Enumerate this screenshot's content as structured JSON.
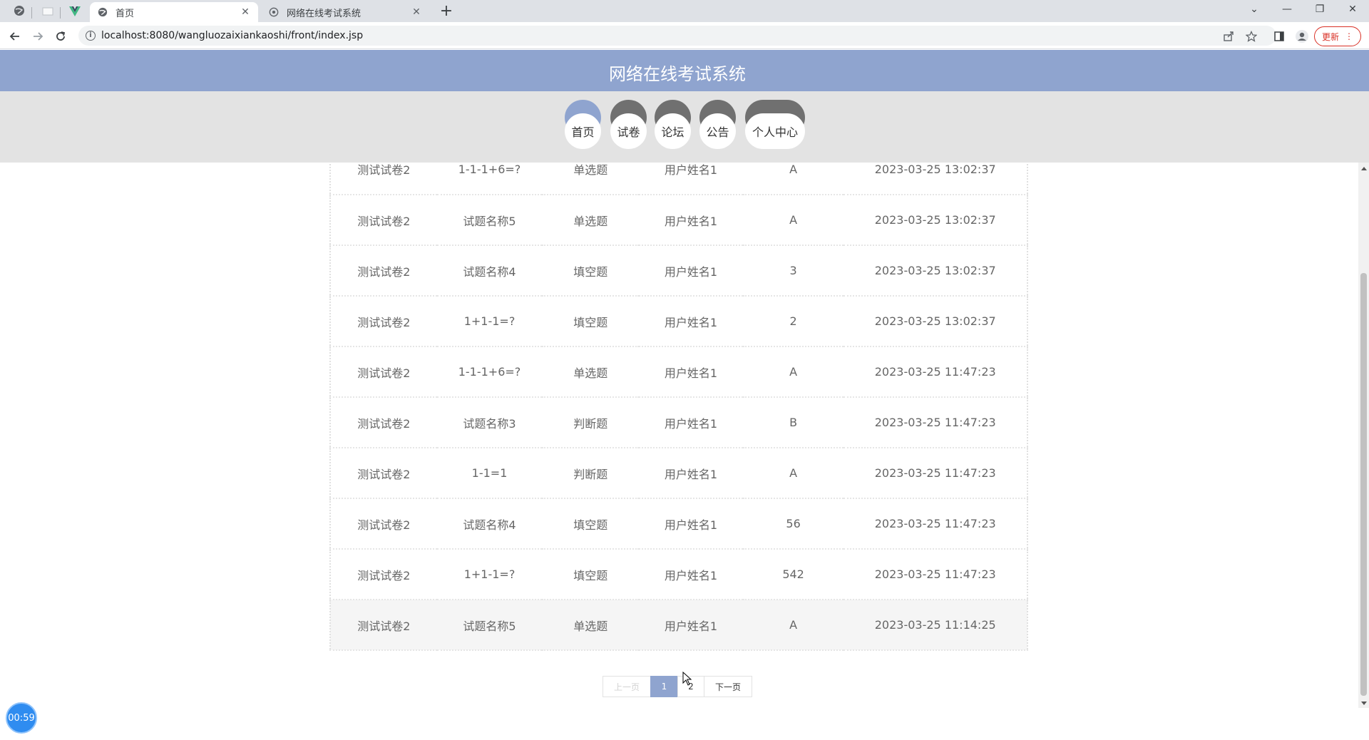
{
  "browser": {
    "tabs": [
      {
        "label": "首页",
        "active": true
      },
      {
        "label": "网络在线考试系统",
        "active": false
      }
    ],
    "url": "localhost:8080/wangluozaixiankaoshi/front/index.jsp",
    "update_label": "更新"
  },
  "site": {
    "title": "网络在线考试系统",
    "nav": [
      {
        "label": "首页",
        "active": true
      },
      {
        "label": "试卷",
        "active": false
      },
      {
        "label": "论坛",
        "active": false
      },
      {
        "label": "公告",
        "active": false
      },
      {
        "label": "个人中心",
        "active": false
      }
    ]
  },
  "records": [
    [
      "测试试卷2",
      "1-1-1+6=?",
      "单选题",
      "用户姓名1",
      "A",
      "2023-03-25 13:02:37"
    ],
    [
      "测试试卷2",
      "试题名称5",
      "单选题",
      "用户姓名1",
      "A",
      "2023-03-25 13:02:37"
    ],
    [
      "测试试卷2",
      "试题名称4",
      "填空题",
      "用户姓名1",
      "3",
      "2023-03-25 13:02:37"
    ],
    [
      "测试试卷2",
      "1+1-1=?",
      "填空题",
      "用户姓名1",
      "2",
      "2023-03-25 13:02:37"
    ],
    [
      "测试试卷2",
      "1-1-1+6=?",
      "单选题",
      "用户姓名1",
      "A",
      "2023-03-25 11:47:23"
    ],
    [
      "测试试卷2",
      "试题名称3",
      "判断题",
      "用户姓名1",
      "B",
      "2023-03-25 11:47:23"
    ],
    [
      "测试试卷2",
      "1-1=1",
      "判断题",
      "用户姓名1",
      "A",
      "2023-03-25 11:47:23"
    ],
    [
      "测试试卷2",
      "试题名称4",
      "填空题",
      "用户姓名1",
      "56",
      "2023-03-25 11:47:23"
    ],
    [
      "测试试卷2",
      "1+1-1=?",
      "填空题",
      "用户姓名1",
      "542",
      "2023-03-25 11:47:23"
    ],
    [
      "测试试卷2",
      "试题名称5",
      "单选题",
      "用户姓名1",
      "A",
      "2023-03-25 11:14:25"
    ]
  ],
  "pagination": {
    "prev_label": "上一页",
    "pages": [
      "1",
      "2"
    ],
    "current": "1",
    "next_label": "下一页"
  },
  "timer": "00:59",
  "colors": {
    "accent": "#8fa4cf",
    "nav_cap": "#707070",
    "timer": "#2f8cf0"
  }
}
